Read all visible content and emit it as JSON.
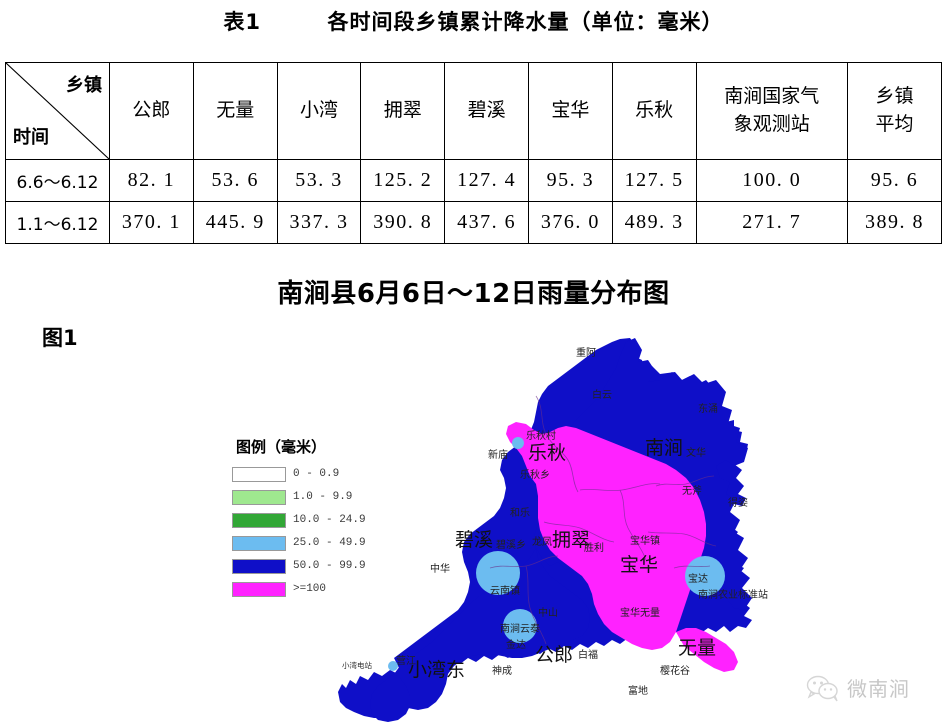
{
  "table": {
    "title": "表1        各时间段乡镇累计降水量（单位：毫米）",
    "corner": {
      "top_right_label": "乡镇",
      "bottom_left_label": "时间"
    },
    "columns": [
      "公郎",
      "无量",
      "小湾",
      "拥翠",
      "碧溪",
      "宝华",
      "乐秋",
      "南涧国家气\n象观测站",
      "乡镇\n平均"
    ],
    "rows": [
      {
        "label": "6.6～6.12",
        "values": [
          "82. 1",
          "53. 6",
          "53. 3",
          "125. 2",
          "127. 4",
          "95. 3",
          "127. 5",
          "100. 0",
          "95. 6"
        ]
      },
      {
        "label": "1.1～6.12",
        "values": [
          "370. 1",
          "445. 9",
          "337. 3",
          "390. 8",
          "437. 6",
          "376. 0",
          "489. 3",
          "271. 7",
          "389. 8"
        ]
      }
    ]
  },
  "figure": {
    "title": "南涧县6月6日～12日雨量分布图",
    "label": "图1",
    "legend": {
      "title": "图例（毫米）",
      "entries": [
        {
          "label": "0 - 0.9",
          "color": "#ffffff"
        },
        {
          "label": "1.0 - 9.9",
          "color": "#9fe88f"
        },
        {
          "label": "10.0 - 24.9",
          "color": "#32a736"
        },
        {
          "label": "25.0 - 49.9",
          "color": "#6cbcf0"
        },
        {
          "label": "50.0 - 99.9",
          "color": "#0f0fc8"
        },
        {
          "label": ">=100",
          "color": "#ff22ff"
        }
      ]
    },
    "map": {
      "township_labels": [
        "南涧",
        "乐秋",
        "碧溪",
        "拥翠",
        "宝华",
        "公郎",
        "小湾东",
        "无量"
      ],
      "place_labels": [
        "重阿",
        "白云",
        "东涌",
        "文华",
        "无斧",
        "得姿",
        "乐秋村",
        "新庙",
        "乐秋乡",
        "和乐",
        "碧溪乡",
        "龙凤",
        "胜利",
        "宝华镇",
        "宝达",
        "南涧农业标准站",
        "宝华无量",
        "中山",
        "中华",
        "云南镇",
        "南涧云泰",
        "金达",
        "白福",
        "富地",
        "樱花谷",
        "神成",
        "小湾",
        "营江",
        "小湾电站"
      ]
    }
  },
  "watermark": {
    "text": "微南涧",
    "icon": "wechat-icon"
  },
  "chart_data": {
    "type": "map",
    "title": "南涧县6月6日～12日雨量分布图",
    "unit": "毫米",
    "legend_position": "left",
    "bins": [
      {
        "range": "0 - 0.9",
        "min": 0,
        "max": 0.9,
        "color": "#ffffff"
      },
      {
        "range": "1.0 - 9.9",
        "min": 1.0,
        "max": 9.9,
        "color": "#9fe88f"
      },
      {
        "range": "10.0 - 24.9",
        "min": 10.0,
        "max": 24.9,
        "color": "#32a736"
      },
      {
        "range": "25.0 - 49.9",
        "min": 25.0,
        "max": 49.9,
        "color": "#6cbcf0"
      },
      {
        "range": "50.0 - 99.9",
        "min": 50.0,
        "max": 99.9,
        "color": "#0f0fc8"
      },
      {
        "range": ">=100",
        "min": 100,
        "max": null,
        "color": "#ff22ff"
      }
    ],
    "categories": [
      "公郎",
      "无量",
      "小湾",
      "拥翠",
      "碧溪",
      "宝华",
      "乐秋",
      "南涧国家气象观测站",
      "乡镇平均"
    ],
    "series": [
      {
        "name": "6.6～6.12",
        "values": [
          82.1,
          53.6,
          53.3,
          125.2,
          127.4,
          95.3,
          127.5,
          100.0,
          95.6
        ]
      },
      {
        "name": "1.1～6.12",
        "values": [
          370.1,
          445.9,
          337.3,
          390.8,
          437.6,
          376.0,
          489.3,
          271.7,
          389.8
        ]
      }
    ],
    "ylabel": "累计降水量（毫米）"
  }
}
